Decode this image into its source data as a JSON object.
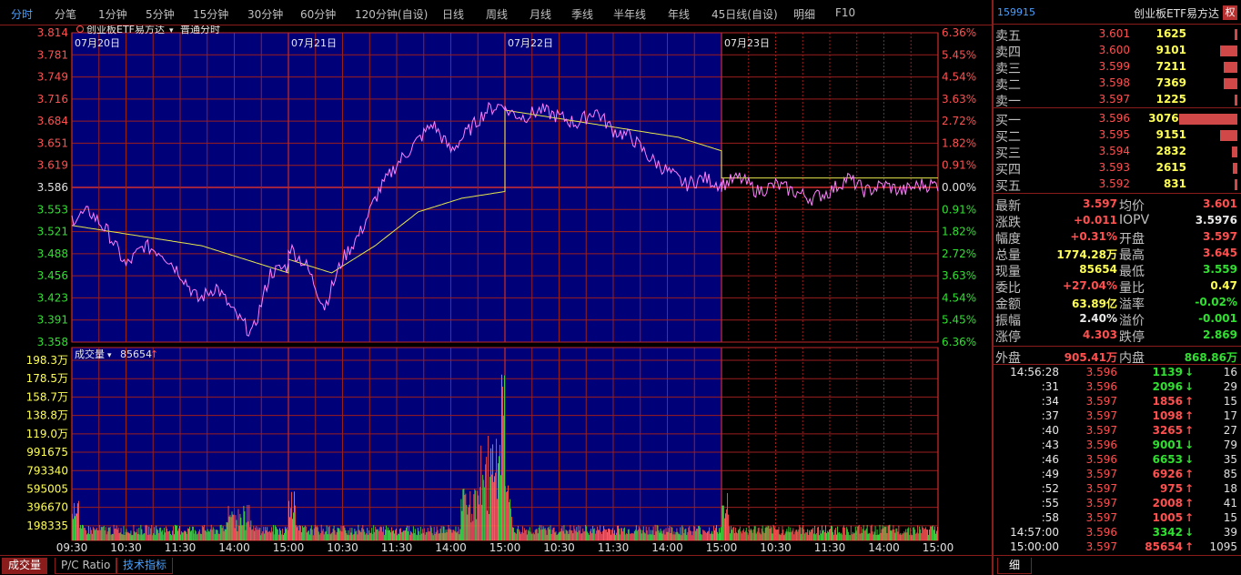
{
  "colors": {
    "up": "#ff5050",
    "down": "#30e030",
    "price_line": "#ff80ff",
    "avg_line": "#e6e64c",
    "grid": "#9a1e1e",
    "panel_bg": "#000078",
    "label_yellow": "#ffff54",
    "accent_blue": "#4aa0ff"
  },
  "period_tabs": [
    {
      "label": "分时",
      "active": true
    },
    {
      "label": "分笔",
      "active": false
    },
    {
      "label": "1分钟",
      "active": false
    },
    {
      "label": "5分钟",
      "active": false
    },
    {
      "label": "15分钟",
      "active": false
    },
    {
      "label": "30分钟",
      "active": false
    },
    {
      "label": "60分钟",
      "active": false
    },
    {
      "label": "120分钟(自设)",
      "active": false
    },
    {
      "label": "日线",
      "active": false
    },
    {
      "label": "周线",
      "active": false
    },
    {
      "label": "月线",
      "active": false
    },
    {
      "label": "季线",
      "active": false
    },
    {
      "label": "半年线",
      "active": false
    },
    {
      "label": "年线",
      "active": false
    },
    {
      "label": "45日线(自设)",
      "active": false
    },
    {
      "label": "明细",
      "active": false
    },
    {
      "label": "F10",
      "active": false
    }
  ],
  "price_panel": {
    "title": "创业板ETF易方达",
    "mode": "普通分时",
    "price_ticks": [
      "3.814",
      "3.781",
      "3.749",
      "3.716",
      "3.684",
      "3.651",
      "3.619",
      "3.586",
      "3.553",
      "3.521",
      "3.488",
      "3.456",
      "3.423",
      "3.391",
      "3.358"
    ],
    "pct_ticks": [
      "6.36%",
      "5.45%",
      "4.54%",
      "3.63%",
      "2.72%",
      "1.82%",
      "0.91%",
      "0.00%",
      "0.91%",
      "1.82%",
      "2.72%",
      "3.63%",
      "4.54%",
      "5.45%",
      "6.36%"
    ],
    "day_labels": [
      "07月20日",
      "07月21日",
      "07月22日",
      "07月23日"
    ],
    "prev_close": 3.586
  },
  "volume_panel": {
    "title": "成交量",
    "current_volume": "85654",
    "vol_ticks": [
      "198.3万",
      "178.5万",
      "158.7万",
      "138.8万",
      "119.0万",
      "991675",
      "793340",
      "595005",
      "396670",
      "198335"
    ]
  },
  "time_ticks": [
    "09:30",
    "10:30",
    "11:30",
    "14:00",
    "15:00",
    "10:30",
    "11:30",
    "14:00",
    "15:00",
    "10:30",
    "11:30",
    "14:00",
    "15:00",
    "10:30",
    "11:30",
    "14:00",
    "15:00"
  ],
  "chart_data": {
    "type": "line",
    "title": "创业板ETF易方达 普通分时",
    "x": [
      "07月20日",
      "07月21日",
      "07月22日",
      "07月23日"
    ],
    "ylim": [
      3.358,
      3.814
    ],
    "series": [
      {
        "name": "price",
        "keypoints_by_day": [
          [
            3.54,
            3.55,
            3.52,
            3.47,
            3.5,
            3.49,
            3.46,
            3.42,
            3.44,
            3.4,
            3.37,
            3.46,
            3.47
          ],
          [
            3.5,
            3.47,
            3.41,
            3.48,
            3.52,
            3.58,
            3.62,
            3.65,
            3.68,
            3.64,
            3.67,
            3.7,
            3.71
          ],
          [
            3.7,
            3.69,
            3.7,
            3.69,
            3.68,
            3.7,
            3.67,
            3.66,
            3.63,
            3.61,
            3.59,
            3.6,
            3.59
          ],
          [
            3.59,
            3.6,
            3.58,
            3.59,
            3.58,
            3.57,
            3.58,
            3.6,
            3.58,
            3.59,
            3.58,
            3.59,
            3.59
          ]
        ]
      },
      {
        "name": "avg_price",
        "keypoints_by_day": [
          [
            3.53,
            3.52,
            3.51,
            3.5,
            3.48,
            3.46
          ],
          [
            3.48,
            3.46,
            3.5,
            3.55,
            3.57,
            3.58
          ],
          [
            3.7,
            3.69,
            3.68,
            3.67,
            3.66,
            3.64
          ],
          [
            3.6,
            3.6,
            3.6,
            3.6,
            3.6,
            3.6
          ]
        ]
      }
    ]
  },
  "bottom_tabs": [
    {
      "label": "成交量",
      "active": true
    },
    {
      "label": "P/C Ratio",
      "active": false
    },
    {
      "label": "技术指标",
      "active": false
    }
  ],
  "quote": {
    "code": "159915",
    "name": "创业板ETF易方达",
    "quan": "权",
    "asks": [
      {
        "label": "卖五",
        "price": "3.601",
        "volume": "1625",
        "bar_frac": 0.05
      },
      {
        "label": "卖四",
        "price": "3.600",
        "volume": "9101",
        "bar_frac": 0.3
      },
      {
        "label": "卖三",
        "price": "3.599",
        "volume": "7211",
        "bar_frac": 0.23
      },
      {
        "label": "卖二",
        "price": "3.598",
        "volume": "7369",
        "bar_frac": 0.24
      },
      {
        "label": "卖一",
        "price": "3.597",
        "volume": "1225",
        "bar_frac": 0.04
      }
    ],
    "bids": [
      {
        "label": "买一",
        "price": "3.596",
        "volume": "30769",
        "bar_frac": 1.0
      },
      {
        "label": "买二",
        "price": "3.595",
        "volume": "9151",
        "bar_frac": 0.3
      },
      {
        "label": "买三",
        "price": "3.594",
        "volume": "2832",
        "bar_frac": 0.09
      },
      {
        "label": "买四",
        "price": "3.593",
        "volume": "2615",
        "bar_frac": 0.08
      },
      {
        "label": "买五",
        "price": "3.592",
        "volume": "831",
        "bar_frac": 0.03
      }
    ],
    "stats": [
      {
        "l1": "最新",
        "v1": "3.597",
        "c1": "red",
        "l2": "均价",
        "v2": "3.601",
        "c2": "red"
      },
      {
        "l1": "涨跌",
        "v1": "+0.011",
        "c1": "red",
        "l2": "IOPV",
        "v2": "3.5976",
        "c2": "white"
      },
      {
        "l1": "幅度",
        "v1": "+0.31%",
        "c1": "red",
        "l2": "开盘",
        "v2": "3.597",
        "c2": "red"
      },
      {
        "l1": "总量",
        "v1": "1774.28万",
        "c1": "yellow",
        "l2": "最高",
        "v2": "3.645",
        "c2": "red"
      },
      {
        "l1": "现量",
        "v1": "85654",
        "c1": "yellow",
        "l2": "最低",
        "v2": "3.559",
        "c2": "green"
      },
      {
        "l1": "委比",
        "v1": "+27.04%",
        "c1": "red",
        "l2": "量比",
        "v2": "0.47",
        "c2": "yellow"
      },
      {
        "l1": "金额",
        "v1": "63.89亿",
        "c1": "yellow",
        "l2": "溢率",
        "v2": "-0.02%",
        "c2": "green"
      },
      {
        "l1": "振幅",
        "v1": "2.40%",
        "c1": "white",
        "l2": "溢价",
        "v2": "-0.001",
        "c2": "green"
      },
      {
        "l1": "涨停",
        "v1": "4.303",
        "c1": "red",
        "l2": "跌停",
        "v2": "2.869",
        "c2": "green"
      }
    ],
    "outer_label": "外盘",
    "outer_value": "905.41万",
    "inner_label": "内盘",
    "inner_value": "868.86万",
    "ticks": [
      {
        "time": "14:56:28",
        "price": "3.596",
        "pc": "red",
        "vol": "1139",
        "dir": "down",
        "n": "16"
      },
      {
        "time": ":31",
        "price": "3.596",
        "pc": "red",
        "vol": "2096",
        "dir": "down",
        "n": "29"
      },
      {
        "time": ":34",
        "price": "3.597",
        "pc": "red",
        "vol": "1856",
        "dir": "up",
        "n": "15"
      },
      {
        "time": ":37",
        "price": "3.597",
        "pc": "red",
        "vol": "1098",
        "dir": "up",
        "n": "17"
      },
      {
        "time": ":40",
        "price": "3.597",
        "pc": "red",
        "vol": "3265",
        "dir": "up",
        "n": "27"
      },
      {
        "time": ":43",
        "price": "3.596",
        "pc": "red",
        "vol": "9001",
        "dir": "down",
        "n": "79"
      },
      {
        "time": ":46",
        "price": "3.596",
        "pc": "red",
        "vol": "6653",
        "dir": "down",
        "n": "35"
      },
      {
        "time": ":49",
        "price": "3.597",
        "pc": "red",
        "vol": "6926",
        "dir": "up",
        "n": "85"
      },
      {
        "time": ":52",
        "price": "3.597",
        "pc": "red",
        "vol": "975",
        "dir": "up",
        "n": "18"
      },
      {
        "time": ":55",
        "price": "3.597",
        "pc": "red",
        "vol": "2008",
        "dir": "up",
        "n": "41"
      },
      {
        "time": ":58",
        "price": "3.597",
        "pc": "red",
        "vol": "1005",
        "dir": "up",
        "n": "15"
      },
      {
        "time": "14:57:00",
        "price": "3.596",
        "pc": "red",
        "vol": "3342",
        "dir": "down",
        "n": "39"
      },
      {
        "time": "15:00:00",
        "price": "3.597",
        "pc": "red",
        "vol": "85654",
        "dir": "up",
        "n": "1095"
      }
    ],
    "detail_tab": "细"
  }
}
